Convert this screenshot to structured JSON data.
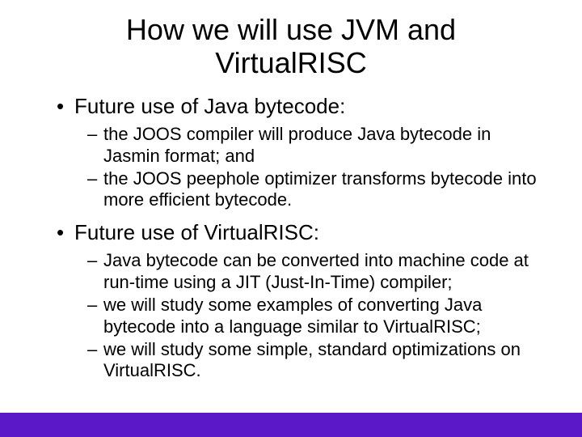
{
  "title": "How we will use JVM and VirtualRISC",
  "bullets": [
    {
      "text": "Future use of Java bytecode:",
      "sub": [
        "the JOOS compiler will produce Java bytecode in Jasmin format; and",
        "the JOOS peephole optimizer transforms bytecode into more efficient bytecode."
      ]
    },
    {
      "text": "Future use of VirtualRISC:",
      "sub": [
        "Java bytecode can be converted into machine code at run-time using a JIT (Just-In-Time) compiler;",
        "we will study some examples of converting Java bytecode into a language similar to VirtualRISC;",
        "we will study some simple, standard optimizations on VirtualRISC."
      ]
    }
  ]
}
